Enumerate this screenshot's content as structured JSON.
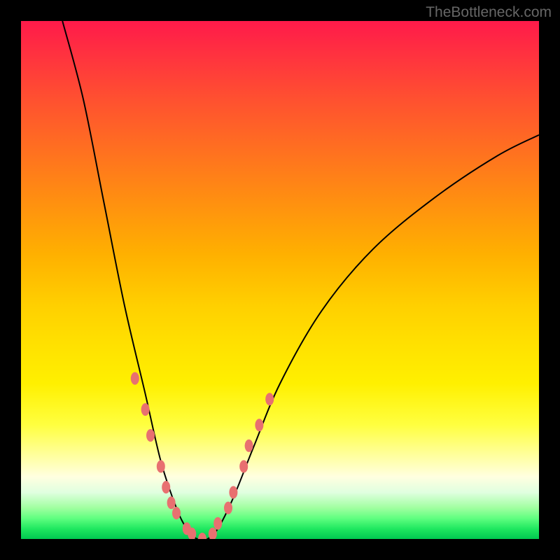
{
  "watermark": "TheBottleneck.com",
  "chart_data": {
    "type": "line",
    "title": "",
    "xlabel": "",
    "ylabel": "",
    "xlim": [
      0,
      100
    ],
    "ylim": [
      0,
      100
    ],
    "background_gradient": {
      "direction": "vertical",
      "stops": [
        {
          "pos": 0,
          "color": "#ff1a4a"
        },
        {
          "pos": 50,
          "color": "#ffd000"
        },
        {
          "pos": 88,
          "color": "#ffffe0"
        },
        {
          "pos": 100,
          "color": "#00c850"
        }
      ]
    },
    "series": [
      {
        "name": "bottleneck-curve",
        "stroke": "#000000",
        "points": [
          {
            "x": 8,
            "y": 100
          },
          {
            "x": 12,
            "y": 85
          },
          {
            "x": 16,
            "y": 65
          },
          {
            "x": 20,
            "y": 45
          },
          {
            "x": 24,
            "y": 28
          },
          {
            "x": 27,
            "y": 15
          },
          {
            "x": 30,
            "y": 6
          },
          {
            "x": 32,
            "y": 2
          },
          {
            "x": 34,
            "y": 0
          },
          {
            "x": 36,
            "y": 0
          },
          {
            "x": 38,
            "y": 2
          },
          {
            "x": 41,
            "y": 8
          },
          {
            "x": 45,
            "y": 18
          },
          {
            "x": 50,
            "y": 30
          },
          {
            "x": 58,
            "y": 44
          },
          {
            "x": 68,
            "y": 56
          },
          {
            "x": 80,
            "y": 66
          },
          {
            "x": 92,
            "y": 74
          },
          {
            "x": 100,
            "y": 78
          }
        ]
      },
      {
        "name": "overlay-dots",
        "type": "scatter",
        "color": "#e87070",
        "points": [
          {
            "x": 22,
            "y": 31
          },
          {
            "x": 24,
            "y": 25
          },
          {
            "x": 25,
            "y": 20
          },
          {
            "x": 27,
            "y": 14
          },
          {
            "x": 28,
            "y": 10
          },
          {
            "x": 29,
            "y": 7
          },
          {
            "x": 30,
            "y": 5
          },
          {
            "x": 32,
            "y": 2
          },
          {
            "x": 33,
            "y": 1
          },
          {
            "x": 35,
            "y": 0
          },
          {
            "x": 37,
            "y": 1
          },
          {
            "x": 38,
            "y": 3
          },
          {
            "x": 40,
            "y": 6
          },
          {
            "x": 41,
            "y": 9
          },
          {
            "x": 43,
            "y": 14
          },
          {
            "x": 44,
            "y": 18
          },
          {
            "x": 46,
            "y": 22
          },
          {
            "x": 48,
            "y": 27
          }
        ]
      }
    ]
  }
}
